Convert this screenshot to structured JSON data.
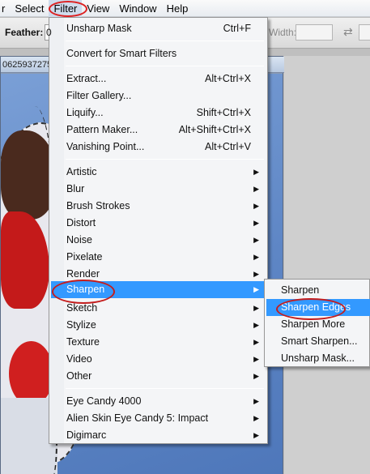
{
  "menubar": {
    "items": [
      {
        "label": "r"
      },
      {
        "label": "Select"
      },
      {
        "label": "Filter"
      },
      {
        "label": "View"
      },
      {
        "label": "Window"
      },
      {
        "label": "Help"
      }
    ]
  },
  "options": {
    "feather_label": "Feather:",
    "feather_value": "0",
    "width_label": "Width:"
  },
  "document": {
    "tab_title": "0625937275"
  },
  "filter_menu": {
    "items": [
      {
        "label": "Unsharp Mask",
        "shortcut": "Ctrl+F"
      },
      {
        "label": "Convert for Smart Filters",
        "shortcut": ""
      },
      {
        "label": "Extract...",
        "shortcut": "Alt+Ctrl+X"
      },
      {
        "label": "Filter Gallery...",
        "shortcut": ""
      },
      {
        "label": "Liquify...",
        "shortcut": "Shift+Ctrl+X"
      },
      {
        "label": "Pattern Maker...",
        "shortcut": "Alt+Shift+Ctrl+X"
      },
      {
        "label": "Vanishing Point...",
        "shortcut": "Alt+Ctrl+V"
      },
      {
        "label": "Artistic",
        "shortcut": ""
      },
      {
        "label": "Blur",
        "shortcut": ""
      },
      {
        "label": "Brush Strokes",
        "shortcut": ""
      },
      {
        "label": "Distort",
        "shortcut": ""
      },
      {
        "label": "Noise",
        "shortcut": ""
      },
      {
        "label": "Pixelate",
        "shortcut": ""
      },
      {
        "label": "Render",
        "shortcut": ""
      },
      {
        "label": "Sharpen",
        "shortcut": ""
      },
      {
        "label": "Sketch",
        "shortcut": ""
      },
      {
        "label": "Stylize",
        "shortcut": ""
      },
      {
        "label": "Texture",
        "shortcut": ""
      },
      {
        "label": "Video",
        "shortcut": ""
      },
      {
        "label": "Other",
        "shortcut": ""
      },
      {
        "label": "Eye Candy 4000",
        "shortcut": ""
      },
      {
        "label": "Alien Skin Eye Candy 5: Impact",
        "shortcut": ""
      },
      {
        "label": "Digimarc",
        "shortcut": ""
      }
    ],
    "highlighted": "Sharpen"
  },
  "sharpen_submenu": {
    "items": [
      {
        "label": "Sharpen"
      },
      {
        "label": "Sharpen Edges"
      },
      {
        "label": "Sharpen More"
      },
      {
        "label": "Smart Sharpen..."
      },
      {
        "label": "Unsharp Mask..."
      }
    ],
    "highlighted": "Sharpen Edges"
  },
  "colors": {
    "highlight": "#3399ff",
    "annotation_circle": "#c41d1d"
  },
  "icons": {
    "submenu_arrow": "chevron-right-icon",
    "swap": "swap-arrows-icon"
  }
}
